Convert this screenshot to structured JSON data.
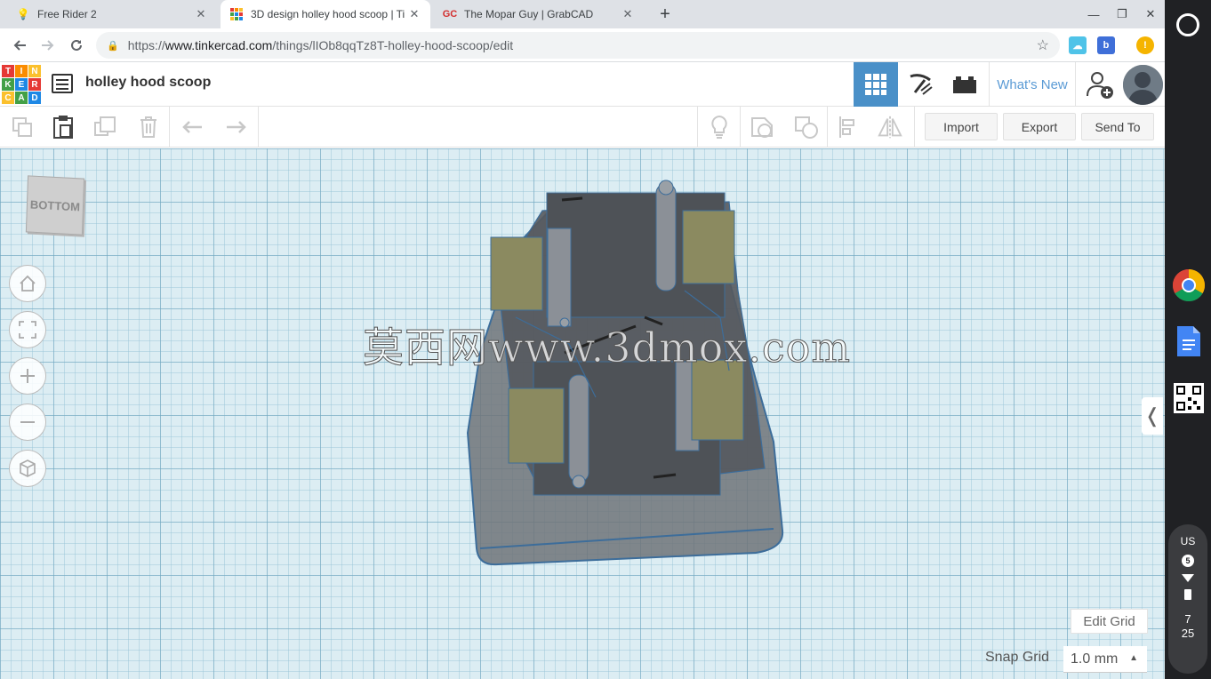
{
  "browser": {
    "tabs": [
      {
        "title": "Free Rider 2",
        "icon": "lightbulb-favicon",
        "active": false
      },
      {
        "title": "3D design holley hood scoop | Ti",
        "icon": "tinkercad-favicon",
        "active": true
      },
      {
        "title": "The Mopar Guy | GrabCAD",
        "icon": "grabcad-favicon",
        "active": false
      }
    ],
    "tab_favicons": [
      "💡",
      "GC"
    ],
    "new_tab_symbol": "+",
    "close_symbol": "✕",
    "window_controls": {
      "minimize": "—",
      "maximize": "❐",
      "close": "✕"
    },
    "url_prefix": "https://",
    "url_host": "www.tinkercad.com",
    "url_path": "/things/lIOb8qqTz8T-holley-hood-scoop/edit",
    "extensions": [
      "cloud-extension",
      "bitly-extension",
      "notification-extension"
    ]
  },
  "header": {
    "logo_letters": [
      "T",
      "I",
      "N",
      "K",
      "E",
      "R",
      "C",
      "A",
      "D"
    ],
    "logo_colors": [
      "#e53935",
      "#fb8c00",
      "#fbc02d",
      "#43a047",
      "#1e88e5",
      "#e53935",
      "#fbc02d",
      "#43a047",
      "#1e88e5"
    ],
    "design_title": "holley hood scoop",
    "whats_new": "What's New",
    "accent": "#4a90c8"
  },
  "edit_toolbar": {
    "import_label": "Import",
    "export_label": "Export",
    "send_to_label": "Send To"
  },
  "workplane": {
    "viewcube_label": "BOTTOM",
    "watermark": "莫西网www.3dmox.com",
    "edit_grid_label": "Edit Grid",
    "snap_grid_label": "Snap Grid",
    "snap_grid_value": "1.0 mm",
    "collapse_symbol": "❬"
  },
  "shelf": {
    "ime": "US",
    "notification_count": "5",
    "time_hour": "7",
    "time_minute": "25"
  }
}
